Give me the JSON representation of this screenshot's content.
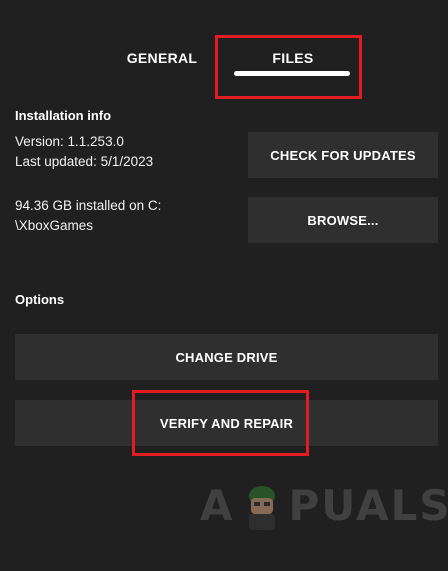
{
  "tabs": [
    {
      "label": "GENERAL",
      "selected": false
    },
    {
      "label": "FILES",
      "selected": true
    }
  ],
  "installation": {
    "heading": "Installation info",
    "version": "Version: 1.1.253.0",
    "last_updated": "Last updated: 5/1/2023",
    "size_line1": "94.36 GB installed on C:",
    "size_line2": "\\XboxGames"
  },
  "buttons": {
    "check_updates": "CHECK FOR UPDATES",
    "browse": "BROWSE...",
    "change_drive": "CHANGE DRIVE",
    "verify_repair": "VERIFY AND REPAIR"
  },
  "options": {
    "heading": "Options"
  },
  "watermark": {
    "left": "A",
    "right": "PUALS"
  },
  "colors": {
    "background": "#202020",
    "button": "#2f2f2f",
    "highlight": "#e31c23"
  }
}
